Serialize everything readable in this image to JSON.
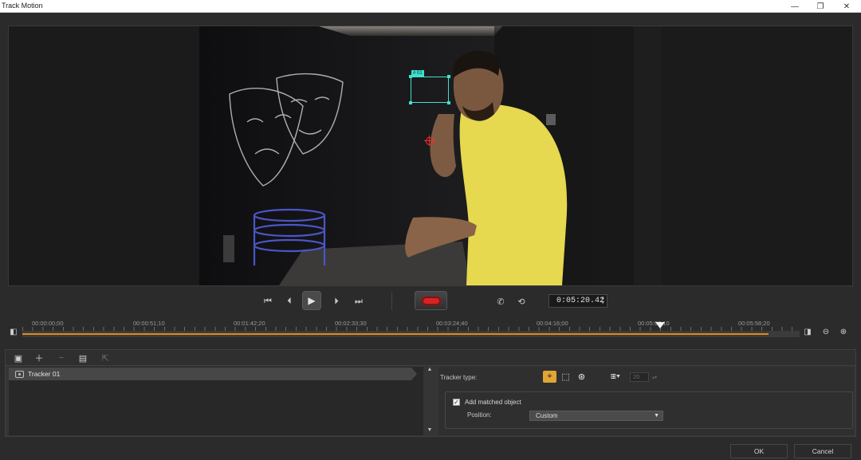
{
  "window": {
    "title": "Track Motion",
    "minimize_glyph": "—",
    "restore_glyph": "❐",
    "close_glyph": "✕"
  },
  "preview": {
    "tracker_label": "# 01"
  },
  "transport": {
    "timecode": "0:05:20.42"
  },
  "timeline": {
    "tick_labels": [
      "00:00:00;00",
      "00:00:51;10",
      "00:01:42;20",
      "00:02:33;30",
      "00:03:24;40",
      "00:04:16;00",
      "00:05:07;10",
      "00:05:58;20"
    ],
    "progress_fraction": 0.96,
    "playhead_fraction": 0.82
  },
  "tracker_list": {
    "items": [
      {
        "label": "Tracker 01"
      }
    ]
  },
  "properties": {
    "tracker_type_label": "Tracker type:",
    "tracker_type_selected": "point",
    "size_value": "20",
    "add_matched_object": {
      "label": "Add matched object",
      "checked": true
    },
    "position": {
      "label": "Position:",
      "value": "Custom"
    }
  },
  "footer": {
    "ok_label": "OK",
    "cancel_label": "Cancel"
  },
  "colors": {
    "accent": "#e0a534",
    "tracker": "#3fe0d0",
    "timeline_fill": "#e08a1e",
    "record": "#d62424"
  }
}
